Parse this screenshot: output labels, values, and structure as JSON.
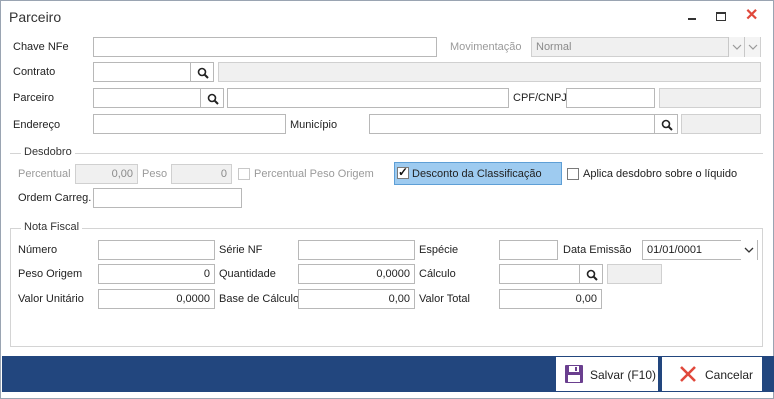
{
  "window": {
    "title": "Parceiro"
  },
  "fields": {
    "chave_nfe": {
      "label": "Chave NFe",
      "value": ""
    },
    "movimentacao": {
      "label": "Movimentação",
      "value": "Normal"
    },
    "contrato": {
      "label": "Contrato",
      "value": "",
      "description": ""
    },
    "parceiro": {
      "label": "Parceiro",
      "value": "",
      "name": ""
    },
    "cpf_cnpj": {
      "label": "CPF/CNPJ",
      "value": "",
      "extra": ""
    },
    "endereco": {
      "label": "Endereço",
      "value": ""
    },
    "municipio": {
      "label": "Município",
      "value": "",
      "extra": ""
    }
  },
  "desdobro": {
    "title": "Desdobro",
    "percentual": {
      "label": "Percentual",
      "value": "0,00"
    },
    "peso": {
      "label": "Peso",
      "value": "0"
    },
    "percentual_peso_origem": {
      "label": "Percentual Peso Origem",
      "checked": false
    },
    "desconto_classificacao": {
      "label": "Desconto da Classificação",
      "checked": true
    },
    "aplica_desdobro": {
      "label": "Aplica desdobro sobre o líquido",
      "checked": false
    },
    "ordem_carreg": {
      "label": "Ordem Carreg.",
      "value": ""
    }
  },
  "nota_fiscal": {
    "title": "Nota Fiscal",
    "numero": {
      "label": "Número",
      "value": ""
    },
    "serie_nf": {
      "label": "Série NF",
      "value": ""
    },
    "especie": {
      "label": "Espécie",
      "value": ""
    },
    "data_emissao": {
      "label": "Data Emissão",
      "value": "01/01/0001"
    },
    "peso_origem": {
      "label": "Peso Origem",
      "value": "0"
    },
    "quantidade": {
      "label": "Quantidade",
      "value": "0,0000"
    },
    "calculo": {
      "label": "Cálculo",
      "value": "",
      "extra": ""
    },
    "valor_unitario": {
      "label": "Valor Unitário",
      "value": "0,0000"
    },
    "base_calculo": {
      "label": "Base de Cálculo",
      "value": "0,00"
    },
    "valor_total": {
      "label": "Valor Total",
      "value": "0,00"
    }
  },
  "footer": {
    "save": {
      "label": "Salvar (F10)",
      "icon": "save-icon"
    },
    "cancel": {
      "label": "Cancelar",
      "icon": "close-icon"
    }
  },
  "colors": {
    "footer_bg": "#22467e",
    "checkbox_highlight": "#9ecbf0",
    "close_icon": "#e0483b",
    "save_icon": "#6a3f8f"
  }
}
